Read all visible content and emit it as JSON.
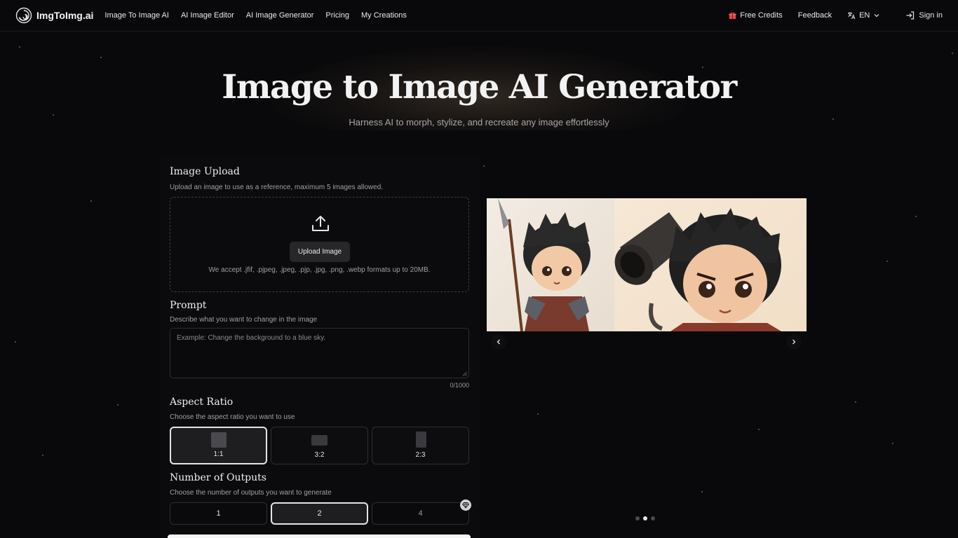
{
  "nav": {
    "brand": "ImgToImg.ai",
    "links": [
      "Image To Image AI",
      "AI Image Editor",
      "AI Image Generator",
      "Pricing",
      "My Creations"
    ],
    "free_credits": "Free Credits",
    "feedback": "Feedback",
    "language": "EN",
    "sign_in": "Sign in"
  },
  "hero": {
    "title": "Image to Image AI Generator",
    "subtitle": "Harness AI to morph, stylize, and recreate any image effortlessly"
  },
  "upload": {
    "title": "Image Upload",
    "description": "Upload an image to use as a reference, maximum 5 images allowed.",
    "button": "Upload Image",
    "accept_note": "We accept .jfif, .pjpeg, .jpeg, .pjp, .jpg, .png, .webp formats up to 20MB."
  },
  "prompt": {
    "title": "Prompt",
    "description": "Describe what you want to change in the image",
    "placeholder": "Example: Change the background to a blue sky.",
    "counter": "0/1000"
  },
  "aspect_ratio": {
    "title": "Aspect Ratio",
    "description": "Choose the aspect ratio you want to use",
    "options": [
      "1:1",
      "3:2",
      "2:3"
    ],
    "selected": "1:1"
  },
  "outputs": {
    "title": "Number of Outputs",
    "description": "Choose the number of outputs you want to generate",
    "options": [
      "1",
      "2",
      "4"
    ],
    "selected": "2"
  },
  "carousel": {
    "slide_count": 3,
    "active_slide": 2
  },
  "colors": {
    "background": "#09090b",
    "accent_gift": "#ef4444"
  }
}
